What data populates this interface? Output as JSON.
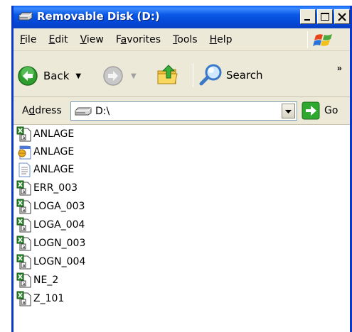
{
  "window": {
    "title": "Removable Disk (D:)",
    "title_icon": "drive-icon"
  },
  "menu": [
    {
      "label_u": "F",
      "label_rest": "ile"
    },
    {
      "label_u": "E",
      "label_rest": "dit"
    },
    {
      "label_u": "V",
      "label_rest": "iew"
    },
    {
      "label_pre": "F",
      "label_u": "a",
      "label_rest": "vorites"
    },
    {
      "label_u": "T",
      "label_rest": "ools"
    },
    {
      "label_u": "H",
      "label_rest": "elp"
    }
  ],
  "toolbar": {
    "back_label": "Back",
    "search_label": "Search",
    "overflow": "»"
  },
  "address": {
    "label_pre": "A",
    "label_u": "d",
    "label_rest": "dress",
    "value": "D:\\",
    "go_label": "Go"
  },
  "files": [
    {
      "name": "ANLAGE",
      "icon": "excel-file-icon"
    },
    {
      "name": "ANLAGE",
      "icon": "program-file-icon"
    },
    {
      "name": "ANLAGE",
      "icon": "text-file-icon"
    },
    {
      "name": "ERR_003",
      "icon": "excel-file-icon"
    },
    {
      "name": "LOGA_003",
      "icon": "excel-file-icon"
    },
    {
      "name": "LOGA_004",
      "icon": "excel-file-icon"
    },
    {
      "name": "LOGN_003",
      "icon": "excel-file-icon"
    },
    {
      "name": "LOGN_004",
      "icon": "excel-file-icon"
    },
    {
      "name": "NE_2",
      "icon": "excel-file-icon"
    },
    {
      "name": "Z_101",
      "icon": "excel-file-icon"
    }
  ],
  "colors": {
    "titlebar": "#0546d6",
    "window_face": "#ece9d8",
    "go_green": "#2fa82f"
  }
}
